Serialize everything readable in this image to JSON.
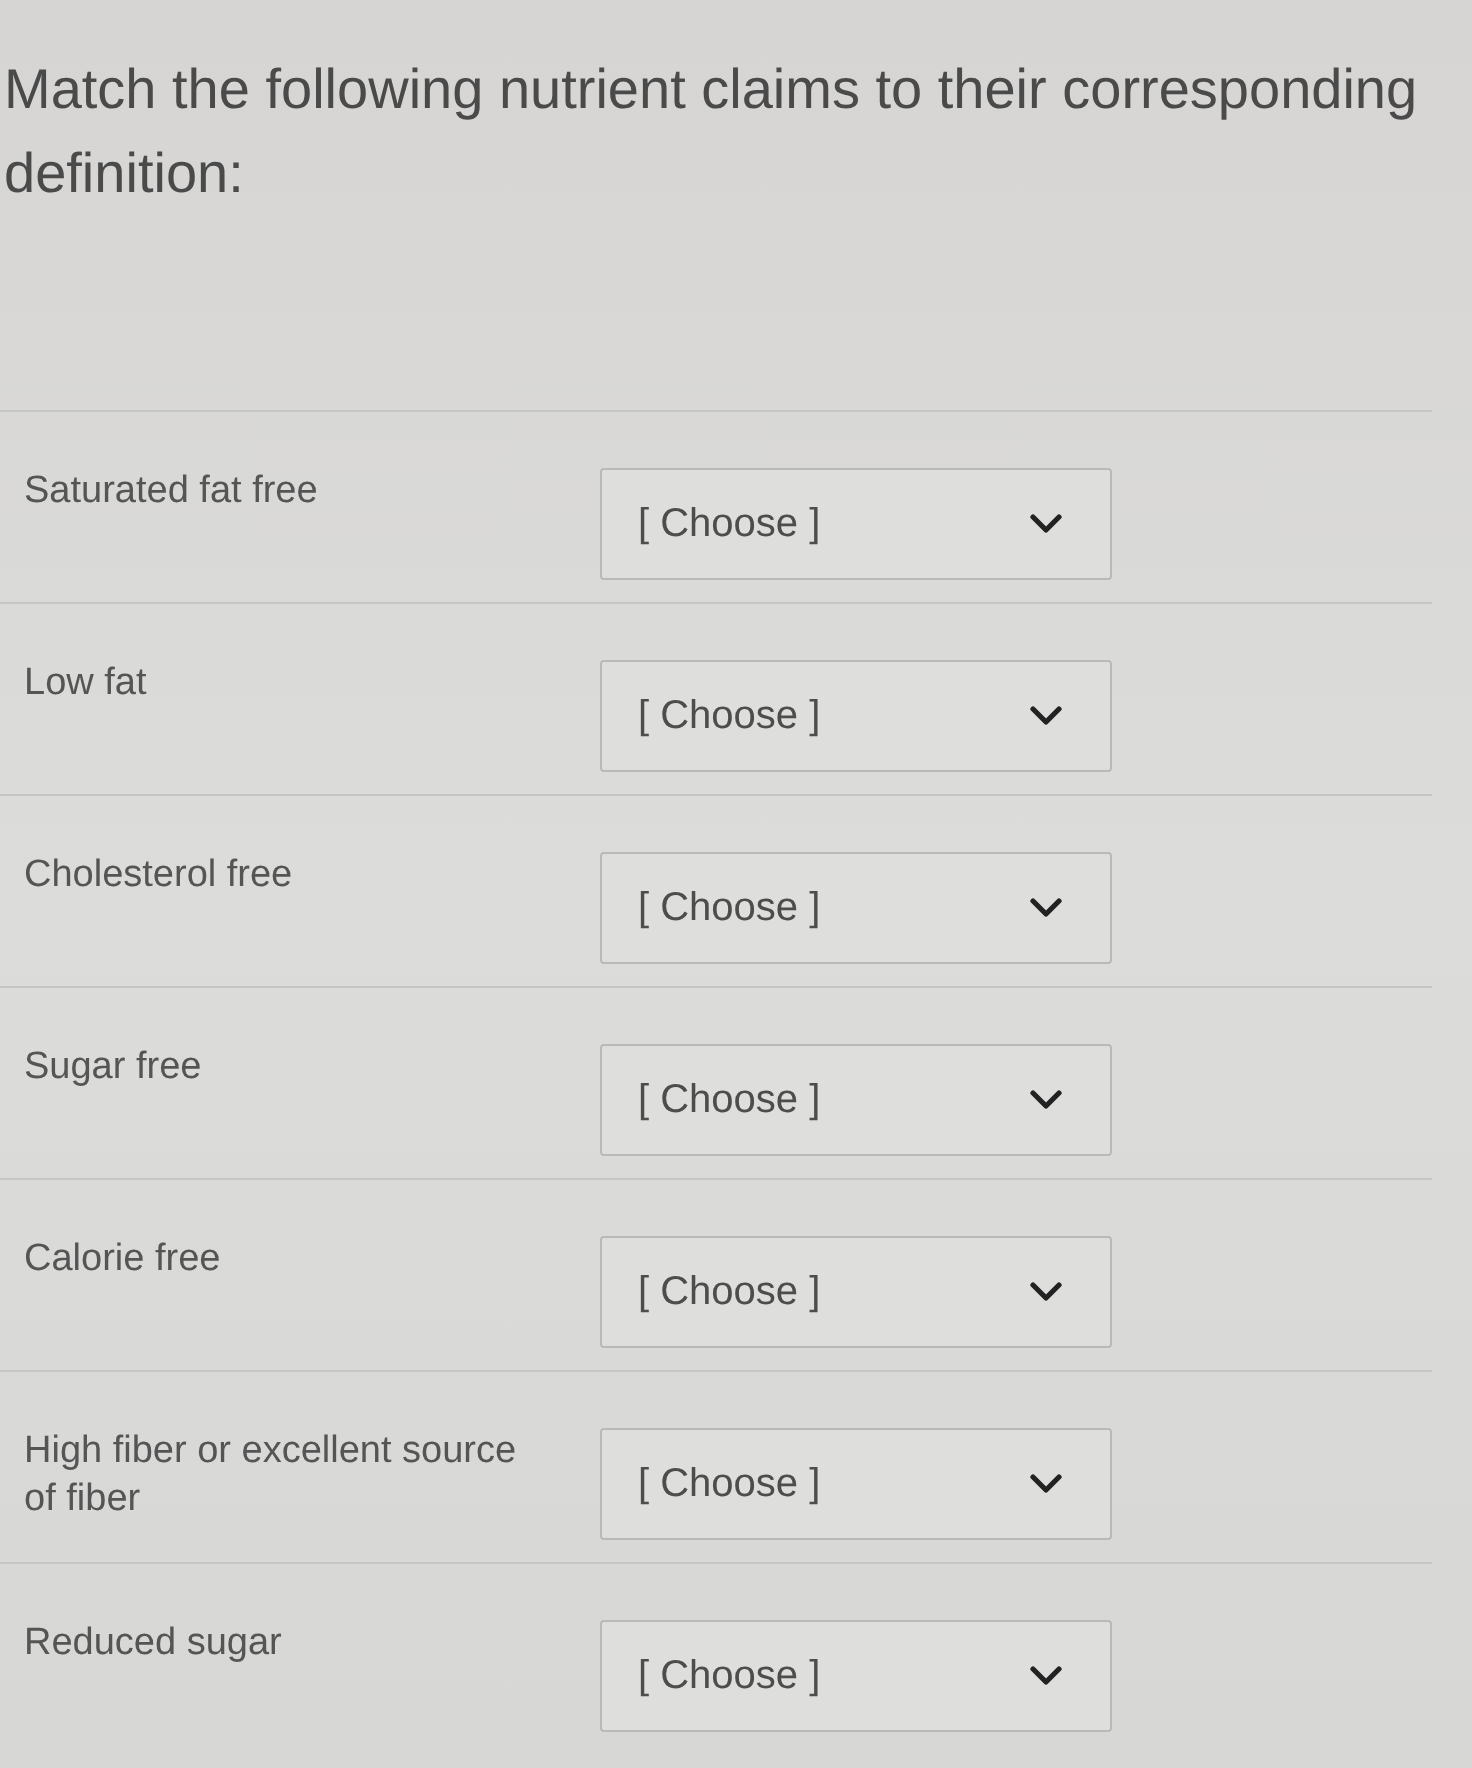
{
  "prompt": "Match the following nutrient claims to their corresponding definition:",
  "rows": [
    {
      "claim": "Saturated fat free",
      "dropdown": {
        "value": "[ Choose ]"
      }
    },
    {
      "claim": "Low fat",
      "dropdown": {
        "value": "[ Choose ]"
      }
    },
    {
      "claim": "Cholesterol free",
      "dropdown": {
        "value": "[ Choose ]"
      }
    },
    {
      "claim": "Sugar free",
      "dropdown": {
        "value": "[ Choose ]"
      }
    },
    {
      "claim": "Calorie free",
      "dropdown": {
        "value": "[ Choose ]"
      }
    },
    {
      "claim": "High fiber or excellent source of fiber",
      "dropdown": {
        "value": "[ Choose ]"
      }
    },
    {
      "claim": "Reduced sugar",
      "dropdown": {
        "value": "[ Choose ]"
      }
    }
  ]
}
